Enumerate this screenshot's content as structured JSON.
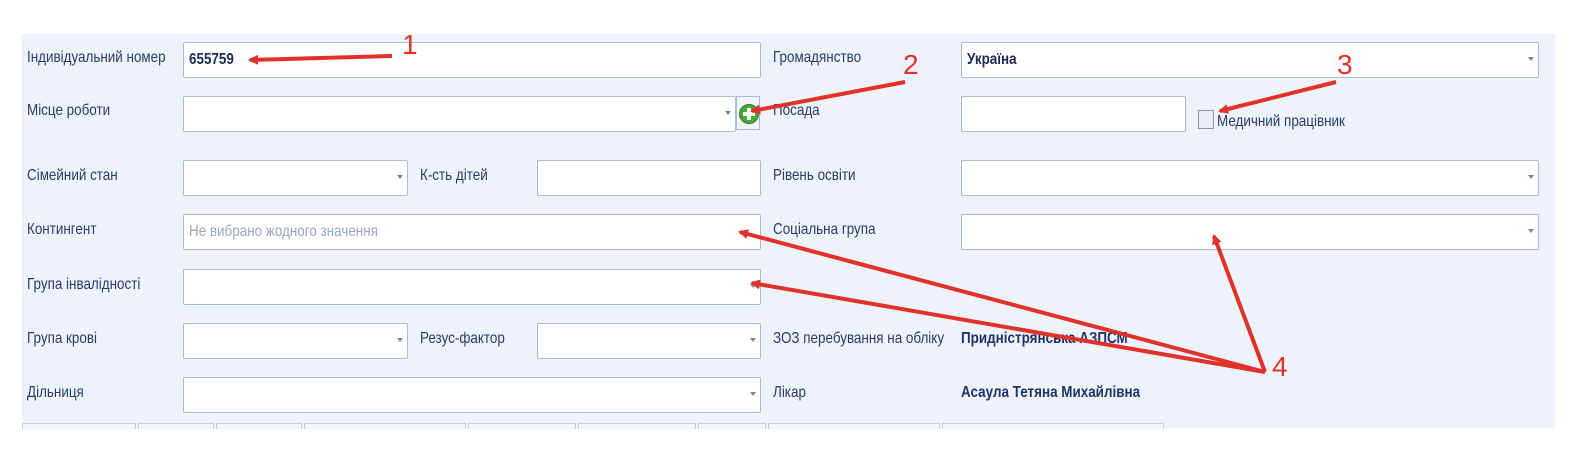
{
  "form": {
    "individual_number": {
      "label": "Індивідуальний номер",
      "value": "655759"
    },
    "citizenship": {
      "label": "Громадянство",
      "value": "Україна"
    },
    "workplace": {
      "label": "Місце роботи",
      "value": ""
    },
    "position": {
      "label": "Посада",
      "value": ""
    },
    "medical_worker": {
      "label": "Медичний працівник",
      "checked": false
    },
    "marital_status": {
      "label": "Сімейний стан",
      "value": ""
    },
    "children_count": {
      "label": "К-сть дітей",
      "value": ""
    },
    "education_level": {
      "label": "Рівень освіти",
      "value": ""
    },
    "contingent": {
      "label": "Контингент",
      "placeholder": "Не вибрано жодного значення"
    },
    "social_group": {
      "label": "Соціальна група",
      "value": ""
    },
    "disability_group": {
      "label": "Група інвалідності",
      "value": ""
    },
    "blood_group": {
      "label": "Група крові",
      "value": ""
    },
    "rh_factor": {
      "label": "Резус-фактор",
      "value": ""
    },
    "registration_facility": {
      "label": "ЗОЗ перебування на обліку",
      "value": "Придністрянська АЗПСМ"
    },
    "district": {
      "label": "Дільниця",
      "value": ""
    },
    "doctor": {
      "label": "Лікар",
      "value": "Асаула Тетяна Михайлівна"
    }
  },
  "annotations": {
    "n1": "1",
    "n2": "2",
    "n3": "3",
    "n4": "4"
  },
  "colors": {
    "annotation": "#e0312a",
    "panel": "#eef3fb",
    "field_border": "#a9bbd8"
  },
  "icons": {
    "add": "plus-circle-icon",
    "dropdown": "chevron-down-icon"
  }
}
